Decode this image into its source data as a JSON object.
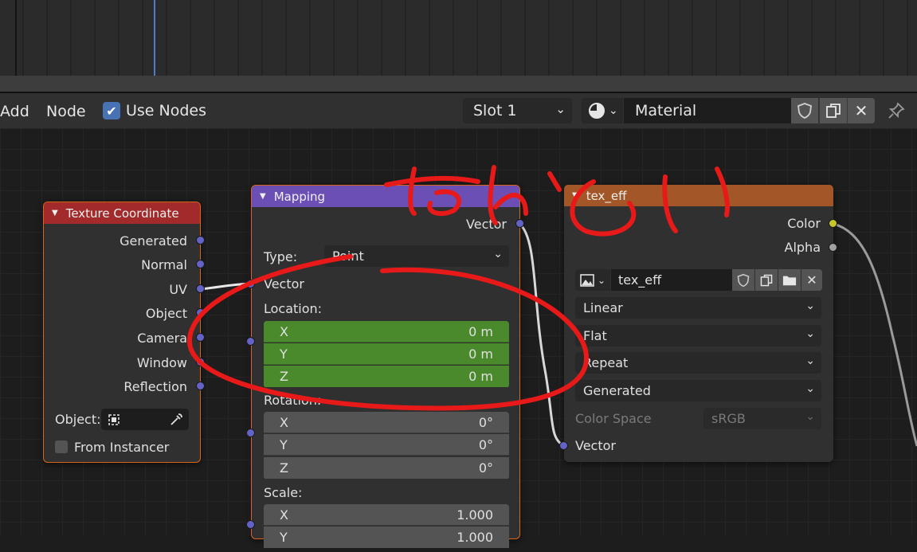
{
  "header": {
    "menu_add": "Add",
    "menu_node": "Node",
    "use_nodes_checked": true,
    "use_nodes_label": "Use Nodes",
    "slot": "Slot 1",
    "material": "Material"
  },
  "texture_coordinate": {
    "title": "Texture Coordinate",
    "outputs": [
      "Generated",
      "Normal",
      "UV",
      "Object",
      "Camera",
      "Window",
      "Reflection"
    ],
    "object_label": "Object:",
    "from_instancer": "From Instancer"
  },
  "mapping": {
    "title": "Mapping",
    "output": "Vector",
    "type_label": "Type:",
    "type_value": "Point",
    "vector_input": "Vector",
    "location_label": "Location:",
    "location": [
      {
        "axis": "X",
        "value": "0 m"
      },
      {
        "axis": "Y",
        "value": "0 m"
      },
      {
        "axis": "Z",
        "value": "0 m"
      }
    ],
    "rotation_label": "Rotation:",
    "rotation": [
      {
        "axis": "X",
        "value": "0°"
      },
      {
        "axis": "Y",
        "value": "0°"
      },
      {
        "axis": "Z",
        "value": "0°"
      }
    ],
    "scale_label": "Scale:",
    "scale": [
      {
        "axis": "X",
        "value": "1.000"
      },
      {
        "axis": "Y",
        "value": "1.000"
      }
    ]
  },
  "image_texture": {
    "title": "tex_eff",
    "output_color": "Color",
    "output_alpha": "Alpha",
    "image_name": "tex_eff",
    "interpolation": "Linear",
    "projection": "Flat",
    "extension": "Repeat",
    "source": "Generated",
    "color_space_label": "Color Space",
    "color_space": "sRGB",
    "vector_input": "Vector"
  },
  "colors": {
    "texture_coord_header": "#a32a2a",
    "mapping_header": "#6b4fb5",
    "image_texture_header": "#a35728",
    "location_field": "#4a8a2c",
    "annotation_red": "#e81919",
    "socket_vector": "#6363c7",
    "socket_color": "#c7c729"
  }
}
